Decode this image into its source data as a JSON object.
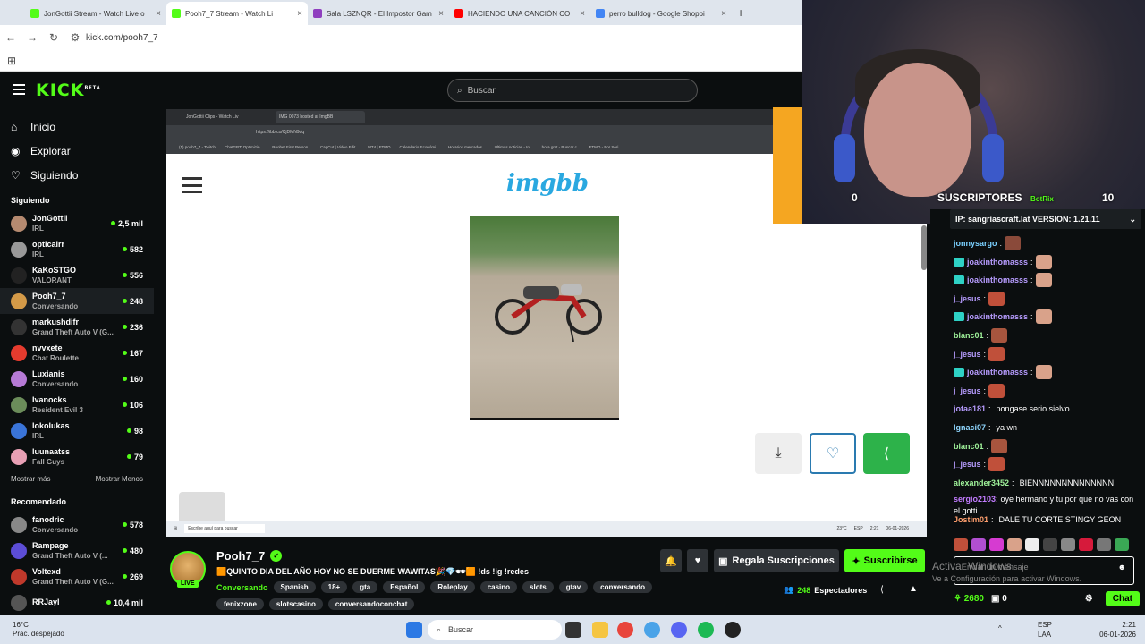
{
  "browser": {
    "tabs": [
      {
        "label": "JonGottii Stream - Watch Live o",
        "color": "#53fc18"
      },
      {
        "label": "Pooh7_7 Stream - Watch Li",
        "color": "#53fc18"
      },
      {
        "label": "Sala LSZNQR - El Impostor Gam",
        "color": "#8f3fbf"
      },
      {
        "label": "HACIENDO UNA CANCIÓN CO",
        "color": "#ff0000"
      },
      {
        "label": "perro bulldog - Google Shoppi",
        "color": "#4285f4"
      }
    ],
    "url": "kick.com/pooh7_7"
  },
  "header": {
    "logo": "KICK",
    "beta": "BETA",
    "search_placeholder": "Buscar"
  },
  "nav": [
    {
      "label": "Inicio",
      "icon": "home-icon",
      "glyph": "⌂"
    },
    {
      "label": "Explorar",
      "icon": "compass-icon",
      "glyph": "◉"
    },
    {
      "label": "Siguiendo",
      "icon": "heart-icon",
      "glyph": "♡"
    }
  ],
  "following_title": "Siguiendo",
  "following": [
    {
      "name": "JonGottii",
      "cat": "IRL",
      "viewers": "2,5 mil",
      "color": "#b58a70"
    },
    {
      "name": "opticalrr",
      "cat": "IRL",
      "viewers": "582",
      "color": "#999"
    },
    {
      "name": "KaKoSTGO",
      "cat": "VALORANT",
      "viewers": "556",
      "color": "#222"
    },
    {
      "name": "Pooh7_7",
      "cat": "Conversando",
      "viewers": "248",
      "color": "#d49a48"
    },
    {
      "name": "markushdifr",
      "cat": "Grand Theft Auto V (G...",
      "viewers": "236",
      "color": "#333"
    },
    {
      "name": "nvvxete",
      "cat": "Chat Roulette",
      "viewers": "167",
      "color": "#e63b2e"
    },
    {
      "name": "Luxianis",
      "cat": "Conversando",
      "viewers": "160",
      "color": "#b67ad6"
    },
    {
      "name": "Ivanocks",
      "cat": "Resident Evil 3",
      "viewers": "106",
      "color": "#6b8c5a"
    },
    {
      "name": "lokolukas",
      "cat": "IRL",
      "viewers": "98",
      "color": "#3a74d8"
    },
    {
      "name": "luunaatss",
      "cat": "Fall Guys",
      "viewers": "79",
      "color": "#e8a0b5"
    }
  ],
  "show_more": "Mostrar más",
  "show_less": "Mostrar Menos",
  "recommended_title": "Recomendado",
  "recommended": [
    {
      "name": "fanodric",
      "cat": "Conversando",
      "viewers": "578",
      "color": "#888"
    },
    {
      "name": "Rampage",
      "cat": "Grand Theft Auto V (...",
      "viewers": "480",
      "color": "#5c4dd6"
    },
    {
      "name": "Voltexd",
      "cat": "Grand Theft Auto V (G...",
      "viewers": "269",
      "color": "#c0392b"
    },
    {
      "name": "RRJayl",
      "cat": "",
      "viewers": "10,4 mil",
      "color": "#555"
    }
  ],
  "stream_view": {
    "inner_tabs": [
      "JonGottii Clips - Watch Liv",
      "IMG 0073 hosted at ImgBB"
    ],
    "inner_url": "https://ibb.co/CjDMN9dq",
    "bookmarks": [
      "(1) pooh7_7 - Twitch",
      "ChatGPT: Optimizin...",
      "Roobet First Person...",
      "CapCut | Video Edit...",
      "MT4 | FTMO",
      "Calendario Económi...",
      "Horarios mercados...",
      "Últimas noticias - In...",
      "hora gmt - Buscar c...",
      "FTMO - For Seri"
    ],
    "site_logo": "imgbb",
    "comment_placeholder": "Escribe aquí para buscar",
    "taskbar_temp": "23°C",
    "taskbar_lang": "ESP",
    "taskbar_time": "2:21",
    "taskbar_date": "06-01-2026"
  },
  "overlay": {
    "subs_left": "0",
    "subs_label": "SUSCRIPTORES",
    "subs_right": "10",
    "bot_name": "BotRix"
  },
  "chat": {
    "pinned": "IP: sangriascraft.lat VERSION: 1.21.11",
    "messages": [
      {
        "user": "jonnysargo",
        "text": "",
        "color": "#7ad0ff",
        "badge": false,
        "emote": "#8a4a3a"
      },
      {
        "user": "joakinthomasss",
        "text": "",
        "color": "#b79cff",
        "badge": true,
        "emote": "#d9a28a"
      },
      {
        "user": "joakinthomasss",
        "text": "",
        "color": "#b79cff",
        "badge": true,
        "emote": "#d9a28a"
      },
      {
        "user": "j_jesus",
        "text": "",
        "color": "#b79cff",
        "badge": false,
        "emote": "#c0503a"
      },
      {
        "user": "joakinthomasss",
        "text": "",
        "color": "#b79cff",
        "badge": true,
        "emote": "#d9a28a"
      },
      {
        "user": "blanc01",
        "text": "",
        "color": "#9ff29a",
        "badge": false,
        "emote": "#a7553e"
      },
      {
        "user": "j_jesus",
        "text": "",
        "color": "#b79cff",
        "badge": false,
        "emote": "#c0503a"
      },
      {
        "user": "joakinthomasss",
        "text": "",
        "color": "#b79cff",
        "badge": true,
        "emote": "#d9a28a"
      },
      {
        "user": "j_jesus",
        "text": "",
        "color": "#b79cff",
        "badge": false,
        "emote": "#c0503a"
      },
      {
        "user": "jotaa181",
        "text": "pongase serio sielvo",
        "color": "#b79cff",
        "badge": false,
        "emote": ""
      },
      {
        "user": "Ignaci07",
        "text": "ya wn",
        "color": "#8fd7ff",
        "badge": false,
        "emote": ""
      },
      {
        "user": "blanc01",
        "text": "",
        "color": "#9ff29a",
        "badge": false,
        "emote": "#a7553e"
      },
      {
        "user": "j_jesus",
        "text": "",
        "color": "#b79cff",
        "badge": false,
        "emote": "#c0503a"
      },
      {
        "user": "alexander3452",
        "text": "BIENNNNNNNNNNNNNN",
        "color": "#9ff29a",
        "badge": false,
        "emote": ""
      },
      {
        "user": "sergio2103",
        "text": "oye hermano y tu por que no vas con el gotti",
        "color": "#c27cff",
        "badge": false,
        "emote": ""
      },
      {
        "user": "Jostim01",
        "text": "DALE TU CORTE STINGY GEON",
        "color": "#ff9f6e",
        "badge": false,
        "emote": ""
      }
    ],
    "input_placeholder": "Enviar un mensaje",
    "points": "2680",
    "gifts": "0",
    "chat_button": "Chat"
  },
  "watermark": {
    "title": "Activar Windows",
    "subtitle": "Ve a Configuración para activar Windows."
  },
  "streamer": {
    "name": "Pooh7_7",
    "live": "LIVE",
    "title": "🟧QUINTO DIA DEL AÑO HOY NO SE DUERME WAWITAS🎉💎🕶🟧 !ds !ig !redes",
    "category": "Conversando",
    "tags": [
      "Spanish",
      "18+",
      "gta",
      "Español",
      "Roleplay",
      "casino",
      "slots",
      "gtav",
      "conversando"
    ],
    "tags2": [
      "fenixzone",
      "slotscasino",
      "conversandoconchat"
    ],
    "gift_subs": "Regala Suscripciones",
    "subscribe": "Suscribirse",
    "viewers": "248",
    "viewers_label": "Espectadores"
  },
  "taskbar": {
    "temp": "16°C",
    "weather": "Prac. despejado",
    "search": "Buscar",
    "lang1": "ESP",
    "lang2": "LAA",
    "time": "2:21",
    "date": "06-01-2026"
  },
  "colors": {
    "accent": "#53fc18",
    "bg": "#0b0e0f"
  }
}
